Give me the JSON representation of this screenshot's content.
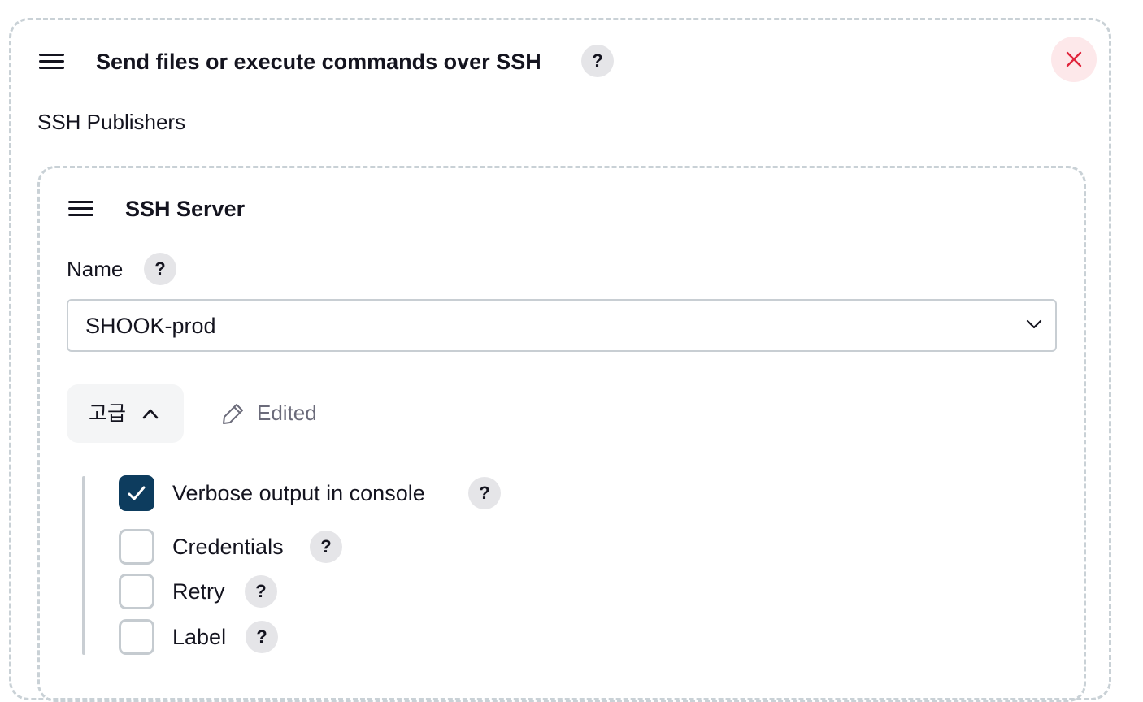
{
  "step": {
    "title": "Send files or execute commands over SSH",
    "help": "?",
    "section_label": "SSH Publishers"
  },
  "server": {
    "title": "SSH Server",
    "name_label": "Name",
    "name_help": "?",
    "name_value": "SHOOK-prod",
    "advanced_label": "고급",
    "edited_label": "Edited"
  },
  "options": [
    {
      "label": "Verbose output in console",
      "checked": true,
      "help": "?"
    },
    {
      "label": "Credentials",
      "checked": false,
      "help": "?"
    },
    {
      "label": "Retry",
      "checked": false,
      "help": "?"
    },
    {
      "label": "Label",
      "checked": false,
      "help": "?"
    }
  ],
  "colors": {
    "accent": "#0d3c5e",
    "close": "#e0243b",
    "close_bg": "#fde8ea"
  }
}
